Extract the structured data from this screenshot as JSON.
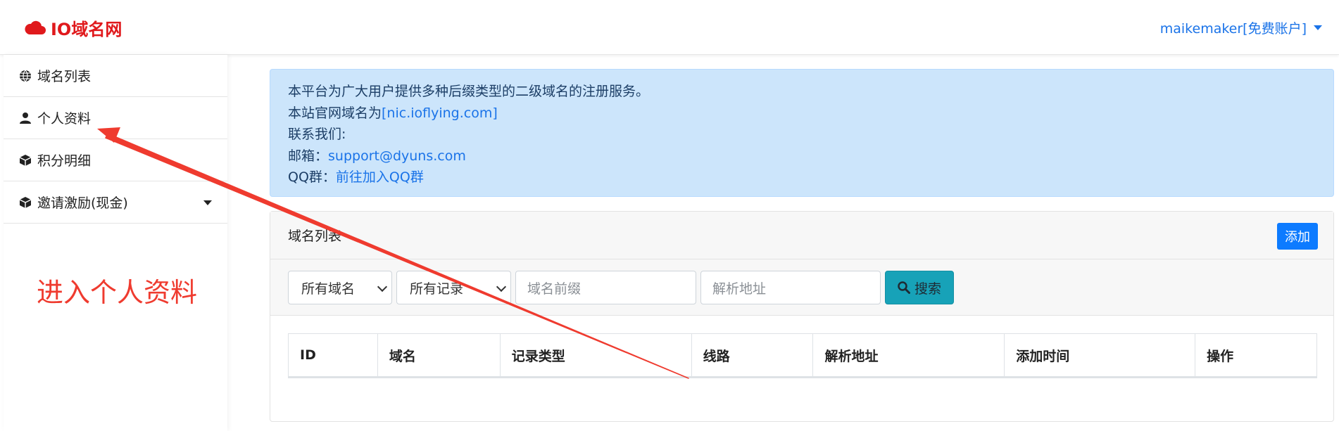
{
  "header": {
    "brand": "IO域名网",
    "user": "maikemaker[免费账户]"
  },
  "sidebar": {
    "items": [
      {
        "label": "域名列表",
        "icon": "globe-icon"
      },
      {
        "label": "个人资料",
        "icon": "user-icon"
      },
      {
        "label": "积分明细",
        "icon": "cube-icon"
      },
      {
        "label": "邀请激励(现金)",
        "icon": "cube-icon"
      }
    ]
  },
  "annotation": {
    "text": "进入个人资料"
  },
  "notice": {
    "line1": "本平台为广大用户提供多种后缀类型的二级域名的注册服务。",
    "line2_prefix": "本站官网域名为",
    "line2_link": "[nic.ioflying.com]",
    "line3": "联系我们:",
    "email_label": "邮箱：",
    "email": "support@dyuns.com",
    "qq_label": "QQ群：",
    "qq_link": "前往加入QQ群"
  },
  "domain_panel": {
    "title": "域名列表",
    "add_label": "添加",
    "filters": {
      "domain_select": "所有域名",
      "record_select": "所有记录",
      "prefix_placeholder": "域名前缀",
      "address_placeholder": "解析地址",
      "search_label": "搜索"
    },
    "table": {
      "columns": [
        "ID",
        "域名",
        "记录类型",
        "线路",
        "解析地址",
        "添加时间",
        "操作"
      ]
    }
  },
  "colors": {
    "brand_red": "#e0191c",
    "link_blue": "#1a73e8",
    "alert_bg": "#cce5fb",
    "primary": "#0d7bff",
    "info": "#17a2b8",
    "annotation_red": "#ef3b2f"
  }
}
